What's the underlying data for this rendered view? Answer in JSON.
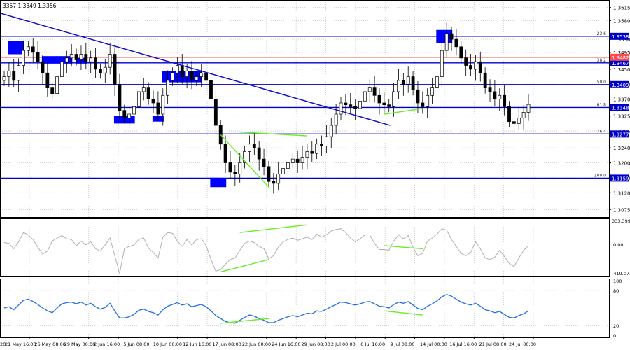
{
  "window": {
    "header_text": "3357 1.3349 1.3356"
  },
  "colors": {
    "level_line": "#0000cc",
    "red_line": "#ff4d4d",
    "box": "#0000ff",
    "trend_line": "#1010cc",
    "divergence": "#66ee22",
    "candle_up": "#ffffff",
    "candle_down": "#000000",
    "cci_line": "#b0b0b0",
    "rsi_line": "#1e6fe6",
    "grid": "#c8c8c8",
    "text": "#000000"
  },
  "x_axis": {
    "labels": [
      "21 May 16:00",
      "26 May 08:00",
      "29 May 00:00",
      "2 Jun 16:00",
      "5 Jun 08:00",
      "10 Jun 00:00",
      "12 Jun 16:00",
      "17 Jun 08:00",
      "22 Jun 00:00",
      "24 Jun 16:00",
      "29 Jun 08:00",
      "2 Jul 00:00",
      "6 Jul 16:00",
      "9 Jul 08:00",
      "14 Jul 00:00",
      "16 Jul 16:00",
      "21 Jul 08:00",
      "24 Jul 00:00"
    ],
    "first_label_partial": "20"
  },
  "price_axis": {
    "ticks": [
      "1.3615",
      "1.3580",
      "1.3530",
      "1.3495",
      "1.3450",
      "1.3410",
      "1.3370",
      "1.3325",
      "1.3285",
      "1.3240",
      "1.3200",
      "1.3160",
      "1.3120",
      "1.3075"
    ],
    "tick_values": [
      1.3615,
      1.358,
      1.353,
      1.3495,
      1.345,
      1.341,
      1.337,
      1.3325,
      1.3285,
      1.324,
      1.32,
      1.316,
      1.312,
      1.3075
    ],
    "current_price": "1.3356"
  },
  "fib_levels": [
    {
      "pct": "23.6",
      "value": "1.3538",
      "price": 1.3538
    },
    {
      "pct": "38.2",
      "value": "1.3467",
      "price": 1.3467
    },
    {
      "pct": "50.0",
      "value": "1.3409",
      "price": 1.3409
    },
    {
      "pct": "61.8",
      "value": "1.3348",
      "price": 1.3348
    },
    {
      "pct": "76.4",
      "value": "1.3277",
      "price": 1.3277
    },
    {
      "pct": "100.0",
      "value": "1.3159",
      "price": 1.3159
    }
  ],
  "red_level": {
    "value": "1.3482",
    "price": 1.3482
  },
  "cci_axis": {
    "top": "333.3997",
    "mid": "0.00",
    "bottom": "-419.071"
  },
  "rsi_axis": {
    "t100": "100",
    "t80": "80",
    "t20": "20",
    "t0": "0"
  },
  "chart_data": {
    "type": "candlestick",
    "title": "",
    "y_range": [
      1.3055,
      1.3635
    ],
    "closes": [
      1.343,
      1.3445,
      1.342,
      1.346,
      1.35,
      1.351,
      1.3495,
      1.347,
      1.344,
      1.34,
      1.3385,
      1.343,
      1.347,
      1.348,
      1.349,
      1.3475,
      1.349,
      1.347,
      1.348,
      1.345,
      1.344,
      1.3455,
      1.349,
      1.341,
      1.334,
      1.332,
      1.333,
      1.335,
      1.339,
      1.34,
      1.337,
      1.336,
      1.333,
      1.338,
      1.342,
      1.344,
      1.346,
      1.343,
      1.3445,
      1.342,
      1.343,
      1.344,
      1.342,
      1.337,
      1.33,
      1.325,
      1.32,
      1.3175,
      1.317,
      1.32,
      1.323,
      1.325,
      1.324,
      1.321,
      1.319,
      1.315,
      1.3145,
      1.317,
      1.3185,
      1.32,
      1.321,
      1.32,
      1.3215,
      1.323,
      1.3225,
      1.325,
      1.3245,
      1.327,
      1.33,
      1.333,
      1.336,
      1.3355,
      1.335,
      1.3345,
      1.3365,
      1.339,
      1.34,
      1.338,
      1.336,
      1.3355,
      1.335,
      1.339,
      1.342,
      1.341,
      1.343,
      1.3395,
      1.336,
      1.335,
      1.338,
      1.34,
      1.343,
      1.35,
      1.3545,
      1.353,
      1.351,
      1.348,
      1.346,
      1.345,
      1.347,
      1.344,
      1.34,
      1.339,
      1.337,
      1.338,
      1.335,
      1.331,
      1.3305,
      1.332,
      1.3335,
      1.3356
    ],
    "cci": [
      20,
      10,
      -60,
      30,
      150,
      120,
      60,
      -40,
      -130,
      -90,
      40,
      80,
      110,
      70,
      60,
      -20,
      40,
      -10,
      30,
      -60,
      -90,
      -10,
      80,
      -150,
      -380,
      -60,
      -30,
      -10,
      60,
      80,
      -50,
      -110,
      -180,
      90,
      150,
      140,
      40,
      -30,
      60,
      -10,
      60,
      70,
      -20,
      -200,
      -350,
      -330,
      -260,
      -200,
      -180,
      -80,
      10,
      40,
      20,
      -30,
      -60,
      -190,
      -150,
      -40,
      30,
      60,
      80,
      50,
      70,
      90,
      60,
      130,
      90,
      120,
      170,
      190,
      200,
      150,
      80,
      30,
      70,
      120,
      120,
      10,
      -70,
      -70,
      -80,
      40,
      120,
      70,
      110,
      -40,
      -150,
      -120,
      40,
      80,
      130,
      200,
      180,
      60,
      -30,
      -120,
      -150,
      -110,
      30,
      -60,
      -180,
      -200,
      -170,
      -80,
      -160,
      -250,
      -290,
      -180,
      -80,
      -20
    ],
    "rsi": [
      50,
      52,
      47,
      55,
      63,
      65,
      61,
      56,
      50,
      45,
      42,
      50,
      57,
      59,
      60,
      57,
      60,
      55,
      58,
      52,
      48,
      51,
      58,
      45,
      33,
      33,
      35,
      39,
      46,
      48,
      44,
      42,
      38,
      47,
      53,
      56,
      59,
      55,
      57,
      52,
      54,
      56,
      52,
      45,
      37,
      32,
      27,
      25,
      24,
      29,
      34,
      38,
      36,
      32,
      29,
      25,
      25,
      29,
      32,
      35,
      37,
      35,
      38,
      41,
      40,
      45,
      44,
      48,
      52,
      56,
      60,
      59,
      57,
      55,
      57,
      60,
      61,
      57,
      53,
      52,
      50,
      56,
      60,
      58,
      61,
      55,
      49,
      47,
      53,
      57,
      62,
      69,
      73,
      70,
      65,
      60,
      57,
      55,
      58,
      53,
      47,
      45,
      42,
      44,
      39,
      34,
      33,
      37,
      40,
      45
    ]
  }
}
